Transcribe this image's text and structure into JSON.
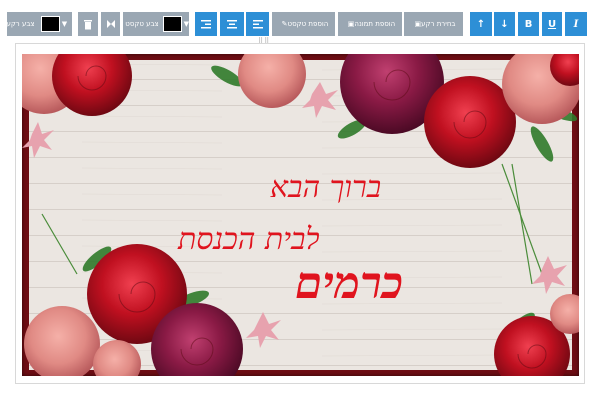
{
  "toolbar": {
    "bg_color_label": "צבע רקע",
    "text_color_label": "צבע טקסט",
    "add_text_label": "הוספת טקסט",
    "add_image_label": "הוספת תמונה",
    "choose_bg_label": "בחירת רקע",
    "bold": "B",
    "underline": "U",
    "italic": "I",
    "bg_color_value": "#000000",
    "text_color_value": "#000000"
  },
  "canvas": {
    "line1": "ברוך הבא",
    "line2": "לבית הכנסת",
    "line3": "כרמים",
    "text_color": "#e0141e",
    "frame_color": "#6e0d14"
  },
  "grip": "⠿⠿"
}
